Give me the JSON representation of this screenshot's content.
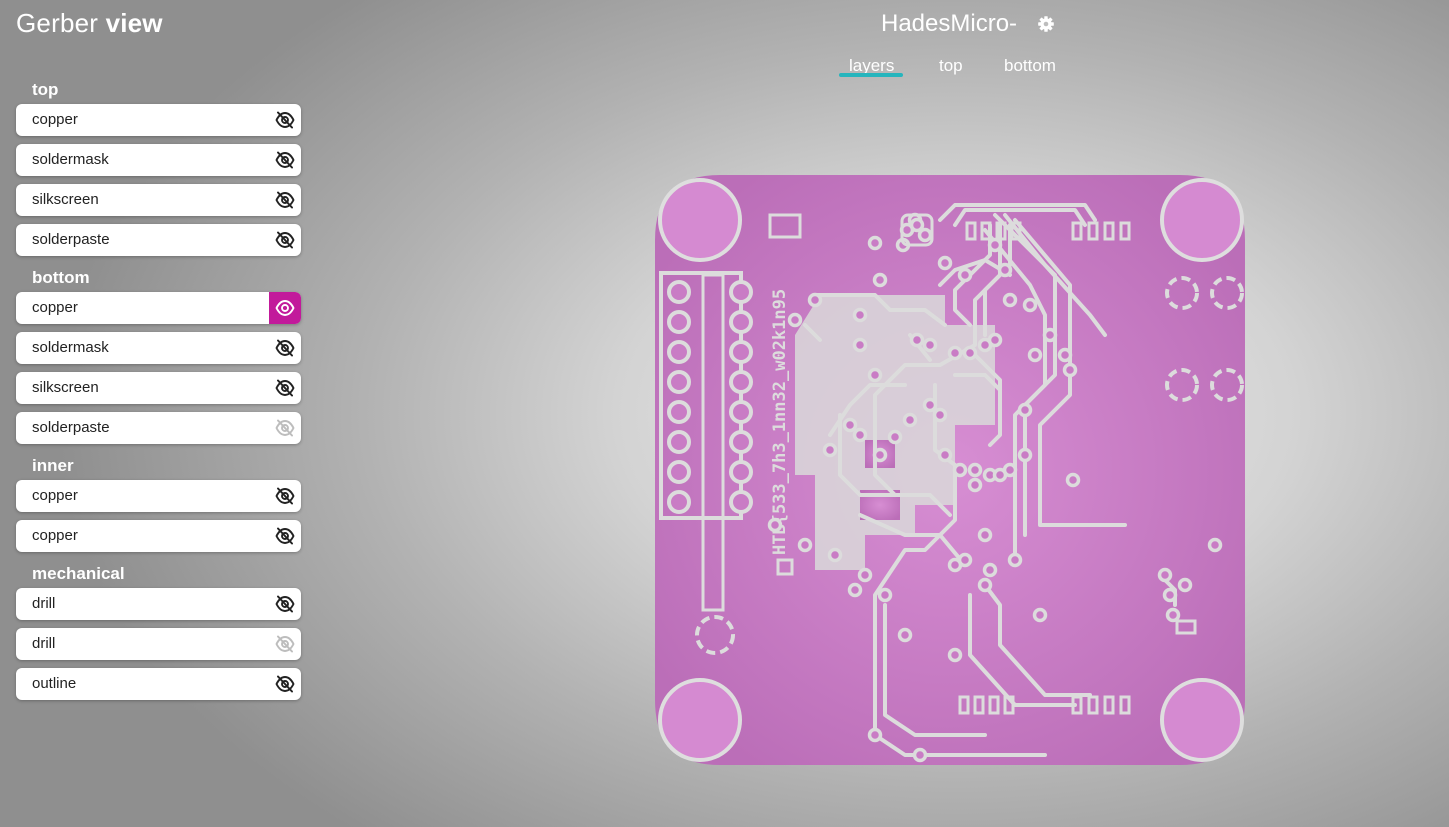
{
  "app": {
    "title_regular": "Gerber",
    "title_bold": "view"
  },
  "board": {
    "name": "HadesMicro-",
    "settings_icon": "gear-icon",
    "silk_text": "HTB{533_7h3_1nn32_w02k1n95"
  },
  "tabs": [
    {
      "label": "layers",
      "active": true
    },
    {
      "label": "top",
      "active": false
    },
    {
      "label": "bottom",
      "active": false
    }
  ],
  "layer_groups": [
    {
      "title": "top",
      "layers": [
        {
          "name": "copper",
          "visibility": "hidden"
        },
        {
          "name": "soldermask",
          "visibility": "hidden"
        },
        {
          "name": "silkscreen",
          "visibility": "hidden"
        },
        {
          "name": "solderpaste",
          "visibility": "hidden"
        }
      ]
    },
    {
      "title": "bottom",
      "layers": [
        {
          "name": "copper",
          "visibility": "visible"
        },
        {
          "name": "soldermask",
          "visibility": "hidden"
        },
        {
          "name": "silkscreen",
          "visibility": "hidden"
        },
        {
          "name": "solderpaste",
          "visibility": "hidden-empty"
        }
      ]
    },
    {
      "title": "inner",
      "layers": [
        {
          "name": "copper",
          "visibility": "hidden"
        },
        {
          "name": "copper",
          "visibility": "hidden"
        }
      ]
    },
    {
      "title": "mechanical",
      "layers": [
        {
          "name": "drill",
          "visibility": "hidden"
        },
        {
          "name": "drill",
          "visibility": "hidden-empty"
        },
        {
          "name": "outline",
          "visibility": "hidden"
        }
      ]
    }
  ],
  "colors": {
    "accent": "#c21a9b",
    "tab_underline": "#26b5bd",
    "copper_fill": "#c87cc4",
    "trace": "#dcdcdc"
  }
}
